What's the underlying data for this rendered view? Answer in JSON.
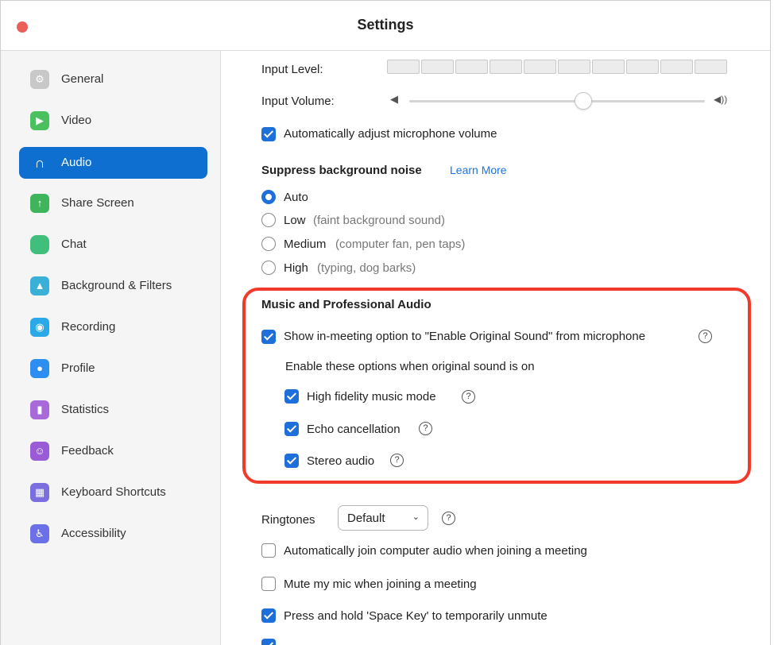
{
  "window": {
    "title": "Settings"
  },
  "sidebar": {
    "items": [
      {
        "label": "General",
        "icon": "gear-icon",
        "color": "#c8c8c8",
        "glyph": "⚙"
      },
      {
        "label": "Video",
        "icon": "video-camera-icon",
        "color": "#4ac15e",
        "glyph": "▶"
      },
      {
        "label": "Audio",
        "icon": "headphones-icon",
        "active": true,
        "glyph": "∩"
      },
      {
        "label": "Share Screen",
        "icon": "share-screen-icon",
        "color": "#3eb55a",
        "glyph": "↑"
      },
      {
        "label": "Chat",
        "icon": "chat-bubble-icon",
        "color": "#3fbf7a",
        "glyph": ""
      },
      {
        "label": "Background & Filters",
        "icon": "background-person-icon",
        "color": "#3ab0d8",
        "glyph": "▲"
      },
      {
        "label": "Recording",
        "icon": "recording-icon",
        "color": "#2aa8e8",
        "glyph": "◉"
      },
      {
        "label": "Profile",
        "icon": "profile-person-icon",
        "color": "#2b8ef0",
        "glyph": "●"
      },
      {
        "label": "Statistics",
        "icon": "statistics-bars-icon",
        "color": "#a86ad8",
        "glyph": "▮"
      },
      {
        "label": "Feedback",
        "icon": "feedback-smiley-icon",
        "color": "#9a5bd6",
        "glyph": "☺"
      },
      {
        "label": "Keyboard Shortcuts",
        "icon": "keyboard-icon",
        "color": "#7b6fe0",
        "glyph": "▦"
      },
      {
        "label": "Accessibility",
        "icon": "accessibility-icon",
        "color": "#6b6fe8",
        "glyph": "♿"
      }
    ]
  },
  "audio": {
    "input_level_label": "Input Level:",
    "input_volume_label": "Input Volume:",
    "auto_adjust_label": "Automatically adjust microphone volume",
    "suppress_title": "Suppress background noise",
    "learn_more": "Learn More",
    "noise_options": [
      {
        "label": "Auto",
        "hint": "",
        "selected": true
      },
      {
        "label": "Low",
        "hint": "(faint background sound)",
        "selected": false
      },
      {
        "label": "Medium",
        "hint": "(computer fan, pen taps)",
        "selected": false
      },
      {
        "label": "High",
        "hint": "(typing, dog barks)",
        "selected": false
      }
    ],
    "music_title": "Music and Professional Audio",
    "show_original_sound": "Show in-meeting option to \"Enable Original Sound\" from microphone",
    "enable_note": "Enable these options when original sound is on",
    "hifi": "High fidelity music mode",
    "echo": "Echo cancellation",
    "stereo": "Stereo audio",
    "ringtones_label": "Ringtones",
    "ringtone_value": "Default",
    "auto_join": "Automatically join computer audio when joining a meeting",
    "mute_mic": "Mute my mic when joining a meeting",
    "space_key": "Press and hold 'Space Key' to temporarily unmute",
    "help_glyph": "?",
    "volume_level": 0.56,
    "input_level_segments": 10
  },
  "colors": {
    "accent": "#1e6fd9",
    "highlight": "#f13a2b",
    "close": "#ec5f59"
  }
}
